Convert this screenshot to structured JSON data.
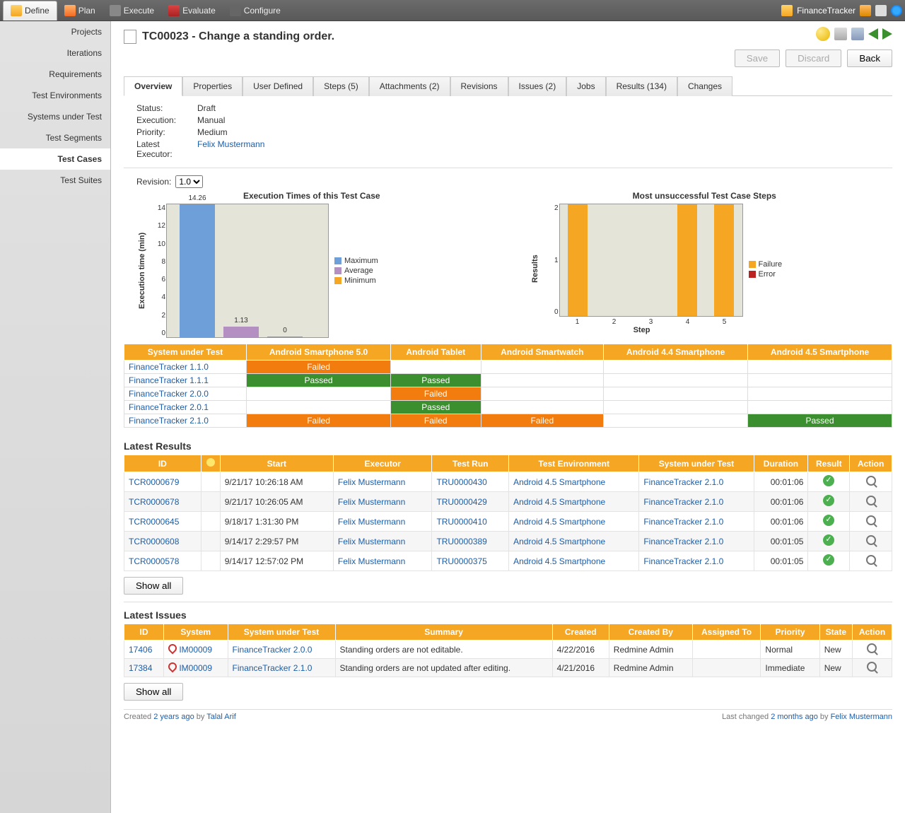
{
  "toolbar": {
    "items": [
      "Define",
      "Plan",
      "Execute",
      "Evaluate",
      "Configure"
    ],
    "project": "FinanceTracker"
  },
  "sidebar": {
    "items": [
      "Projects",
      "Iterations",
      "Requirements",
      "Test Environments",
      "Systems under Test",
      "Test Segments",
      "Test Cases",
      "Test Suites"
    ],
    "active": "Test Cases"
  },
  "page": {
    "title": "TC00023 - Change a standing order."
  },
  "buttons": {
    "save": "Save",
    "discard": "Discard",
    "back": "Back",
    "show_all": "Show all"
  },
  "tabs": [
    "Overview",
    "Properties",
    "User Defined",
    "Steps (5)",
    "Attachments (2)",
    "Revisions",
    "Issues (2)",
    "Jobs",
    "Results (134)",
    "Changes"
  ],
  "meta": {
    "status": {
      "lbl": "Status:",
      "val": "Draft"
    },
    "execution": {
      "lbl": "Execution:",
      "val": "Manual"
    },
    "priority": {
      "lbl": "Priority:",
      "val": "Medium"
    },
    "executor": {
      "lbl": "Latest Executor:",
      "val": "Felix Mustermann"
    }
  },
  "revision": {
    "lbl": "Revision:",
    "val": "1.0"
  },
  "chart_data": [
    {
      "type": "bar",
      "title": "Execution Times of this Test Case",
      "ylabel": "Execution time (min)",
      "ylim": [
        0,
        14
      ],
      "series": [
        {
          "name": "Maximum",
          "values": [
            14.26
          ],
          "color": "#6f9fd8"
        },
        {
          "name": "Average",
          "values": [
            1.13
          ],
          "color": "#b48fc1"
        },
        {
          "name": "Minimum",
          "values": [
            0
          ],
          "color": "#f5a623"
        }
      ]
    },
    {
      "type": "bar",
      "title": "Most unsuccessful Test Case Steps",
      "xlabel": "Step",
      "ylabel": "Results",
      "ylim": [
        0,
        2
      ],
      "categories": [
        1,
        2,
        3,
        4,
        5
      ],
      "series": [
        {
          "name": "Failure",
          "values": [
            2,
            0,
            0,
            2,
            2
          ],
          "color": "#f5a623"
        },
        {
          "name": "Error",
          "values": [
            0,
            0,
            0,
            0,
            0
          ],
          "color": "#b22"
        }
      ]
    }
  ],
  "matrix": {
    "headers": [
      "System under Test",
      "Android Smartphone 5.0",
      "Android Tablet",
      "Android Smartwatch",
      "Android 4.4 Smartphone",
      "Android 4.5 Smartphone"
    ],
    "rows": [
      {
        "name": "FinanceTracker 1.1.0",
        "cells": [
          "Failed",
          "",
          "",
          "",
          ""
        ]
      },
      {
        "name": "FinanceTracker 1.1.1",
        "cells": [
          "Passed",
          "Passed",
          "",
          "",
          ""
        ]
      },
      {
        "name": "FinanceTracker 2.0.0",
        "cells": [
          "",
          "Failed",
          "",
          "",
          ""
        ]
      },
      {
        "name": "FinanceTracker 2.0.1",
        "cells": [
          "",
          "Passed",
          "",
          "",
          ""
        ]
      },
      {
        "name": "FinanceTracker 2.1.0",
        "cells": [
          "Failed",
          "Failed",
          "Failed",
          "",
          "Passed"
        ]
      }
    ]
  },
  "results": {
    "title": "Latest Results",
    "headers": [
      "ID",
      "",
      "Start",
      "Executor",
      "Test Run",
      "Test Environment",
      "System under Test",
      "Duration",
      "Result",
      "Action"
    ],
    "rows": [
      {
        "id": "TCR0000679",
        "start": "9/21/17 10:26:18 AM",
        "executor": "Felix Mustermann",
        "run": "TRU0000430",
        "env": "Android 4.5 Smartphone",
        "sut": "FinanceTracker 2.1.0",
        "dur": "00:01:06"
      },
      {
        "id": "TCR0000678",
        "start": "9/21/17 10:26:05 AM",
        "executor": "Felix Mustermann",
        "run": "TRU0000429",
        "env": "Android 4.5 Smartphone",
        "sut": "FinanceTracker 2.1.0",
        "dur": "00:01:06"
      },
      {
        "id": "TCR0000645",
        "start": "9/18/17 1:31:30 PM",
        "executor": "Felix Mustermann",
        "run": "TRU0000410",
        "env": "Android 4.5 Smartphone",
        "sut": "FinanceTracker 2.1.0",
        "dur": "00:01:06"
      },
      {
        "id": "TCR0000608",
        "start": "9/14/17 2:29:57 PM",
        "executor": "Felix Mustermann",
        "run": "TRU0000389",
        "env": "Android 4.5 Smartphone",
        "sut": "FinanceTracker 2.1.0",
        "dur": "00:01:05"
      },
      {
        "id": "TCR0000578",
        "start": "9/14/17 12:57:02 PM",
        "executor": "Felix Mustermann",
        "run": "TRU0000375",
        "env": "Android 4.5 Smartphone",
        "sut": "FinanceTracker 2.1.0",
        "dur": "00:01:05"
      }
    ]
  },
  "issues": {
    "title": "Latest Issues",
    "headers": [
      "ID",
      "System",
      "System under Test",
      "Summary",
      "Created",
      "Created By",
      "Assigned To",
      "Priority",
      "State",
      "Action"
    ],
    "rows": [
      {
        "id": "17406",
        "sys": "IM00009",
        "sut": "FinanceTracker 2.0.0",
        "summary": "Standing orders are not editable.",
        "created": "4/22/2016",
        "by": "Redmine Admin",
        "assigned": "",
        "priority": "Normal",
        "state": "New"
      },
      {
        "id": "17384",
        "sys": "IM00009",
        "sut": "FinanceTracker 2.1.0",
        "summary": "Standing orders are not updated after editing.",
        "created": "4/21/2016",
        "by": "Redmine Admin",
        "assigned": "",
        "priority": "Immediate",
        "state": "New"
      }
    ]
  },
  "footer": {
    "created_pre": "Created ",
    "created_time": "2 years ago",
    "created_by": " by ",
    "created_author": "Talal Arif",
    "changed_pre": "Last changed ",
    "changed_time": "2 months ago",
    "changed_by": " by ",
    "changed_author": "Felix Mustermann"
  }
}
